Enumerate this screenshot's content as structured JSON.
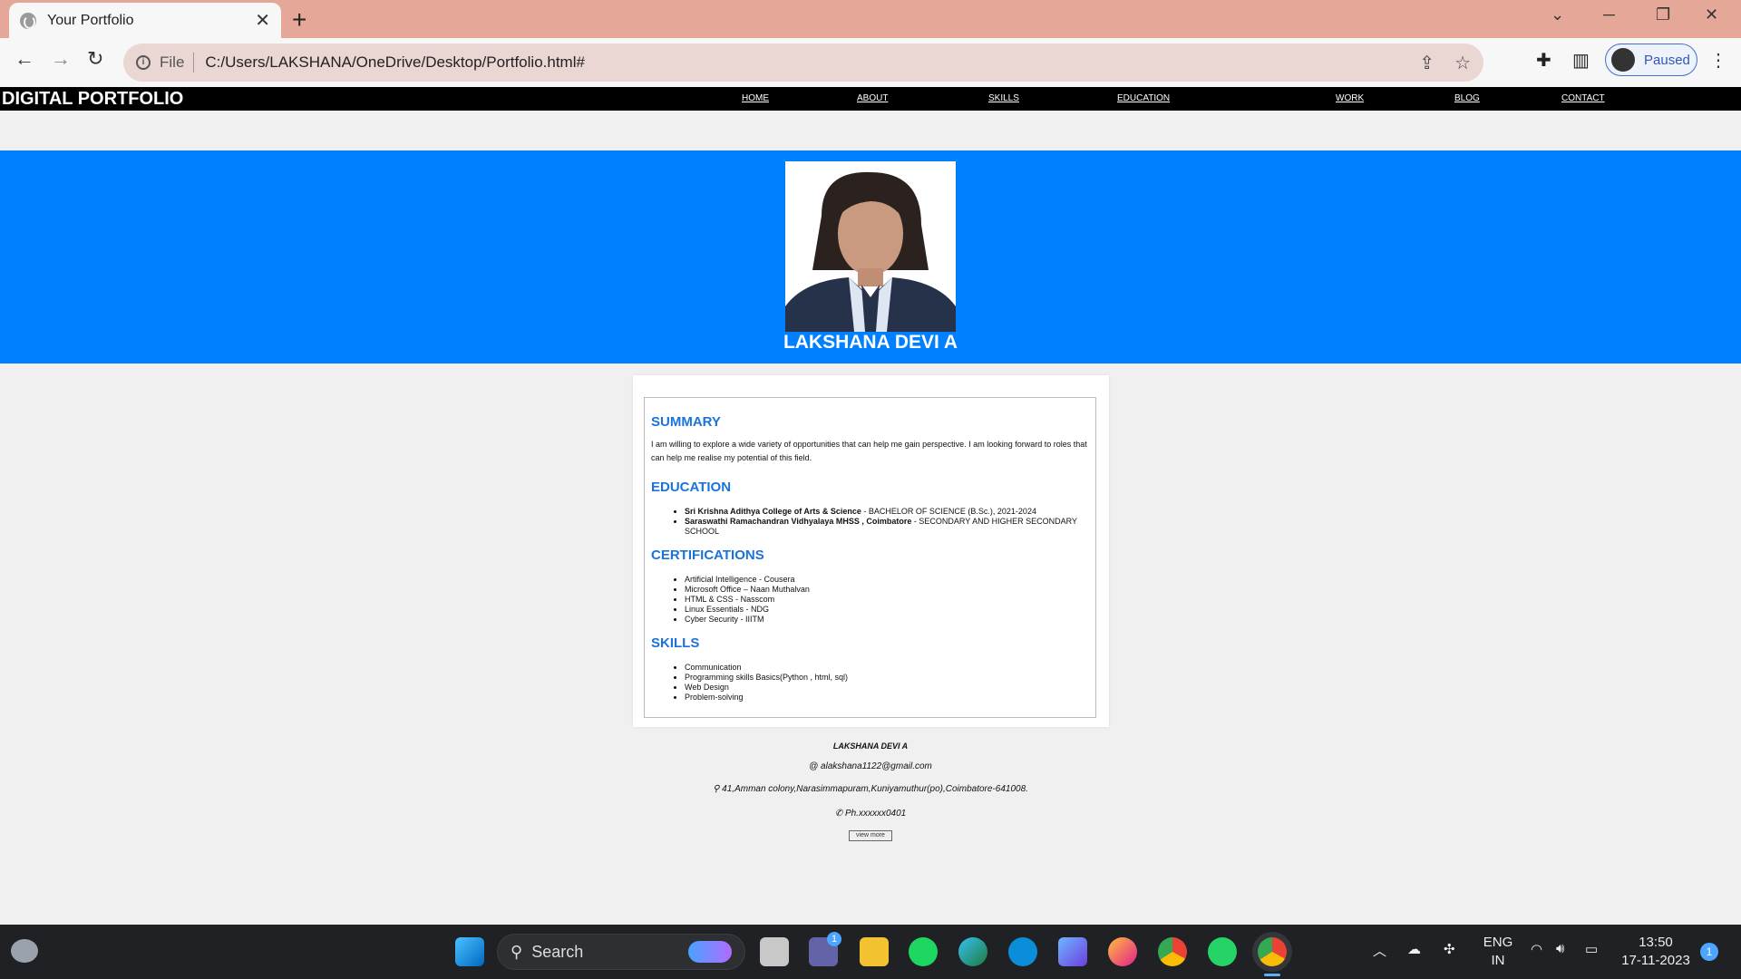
{
  "browser": {
    "tab_title": "Your Portfolio",
    "tab_close": "✕",
    "new_tab": "+",
    "file_label": "File",
    "url": "C:/Users/LAKSHANA/OneDrive/Desktop/Portfolio.html#",
    "profile_status": "Paused"
  },
  "site": {
    "brand": "DIGITAL PORTFOLIO",
    "nav": [
      "HOME",
      "ABOUT",
      "SKILLS",
      "EDUCATION",
      "WORK",
      "BLOG",
      "CONTACT"
    ],
    "name": "LAKSHANA DEVI A",
    "summary_heading": "SUMMARY",
    "summary_text": "I am willing to explore a wide variety of opportunities that can help me gain perspective. I am looking forward to roles that can help me realise my potential of this field.",
    "education_heading": "EDUCATION",
    "education": [
      {
        "school": "Sri Krishna Adithya College of Arts & Science",
        "detail": " - BACHELOR OF SCIENCE (B.Sc.), 2021-2024"
      },
      {
        "school": "Saraswathi Ramachandran Vidhyalaya MHSS , Coimbatore",
        "detail": " - SECONDARY AND HIGHER SECONDARY SCHOOL"
      }
    ],
    "certifications_heading": "CERTIFICATIONS",
    "certifications": [
      "Artificial Intelligence - Cousera",
      "Microsoft Office – Naan Muthalvan",
      "HTML & CSS - Nasscom",
      "Linux Essentials - NDG",
      "Cyber Security - IIITM"
    ],
    "skills_heading": "SKILLS",
    "skills": [
      "Communication",
      "Programming skills Basics(Python , html, sql)",
      "Web Design",
      "Problem-solving"
    ],
    "footer": {
      "name": "LAKSHANA DEVI A",
      "email": "@ alakshana1122@gmail.com",
      "address": "⚲ 41,Amman colony,Narasimmapuram,Kuniyamuthur(po),Coimbatore-641008.",
      "phone": "✆ Ph.xxxxxx0401",
      "view_more": "view more"
    }
  },
  "taskbar": {
    "search_label": "Search",
    "chat_badge": "1",
    "lang_top": "ENG",
    "lang_bottom": "IN",
    "time": "13:50",
    "date": "17-11-2023",
    "notification_count": "1"
  },
  "colors": {
    "hero": "#0080ff",
    "heading": "#1a73d9",
    "chrome_frame": "#e5a898"
  }
}
